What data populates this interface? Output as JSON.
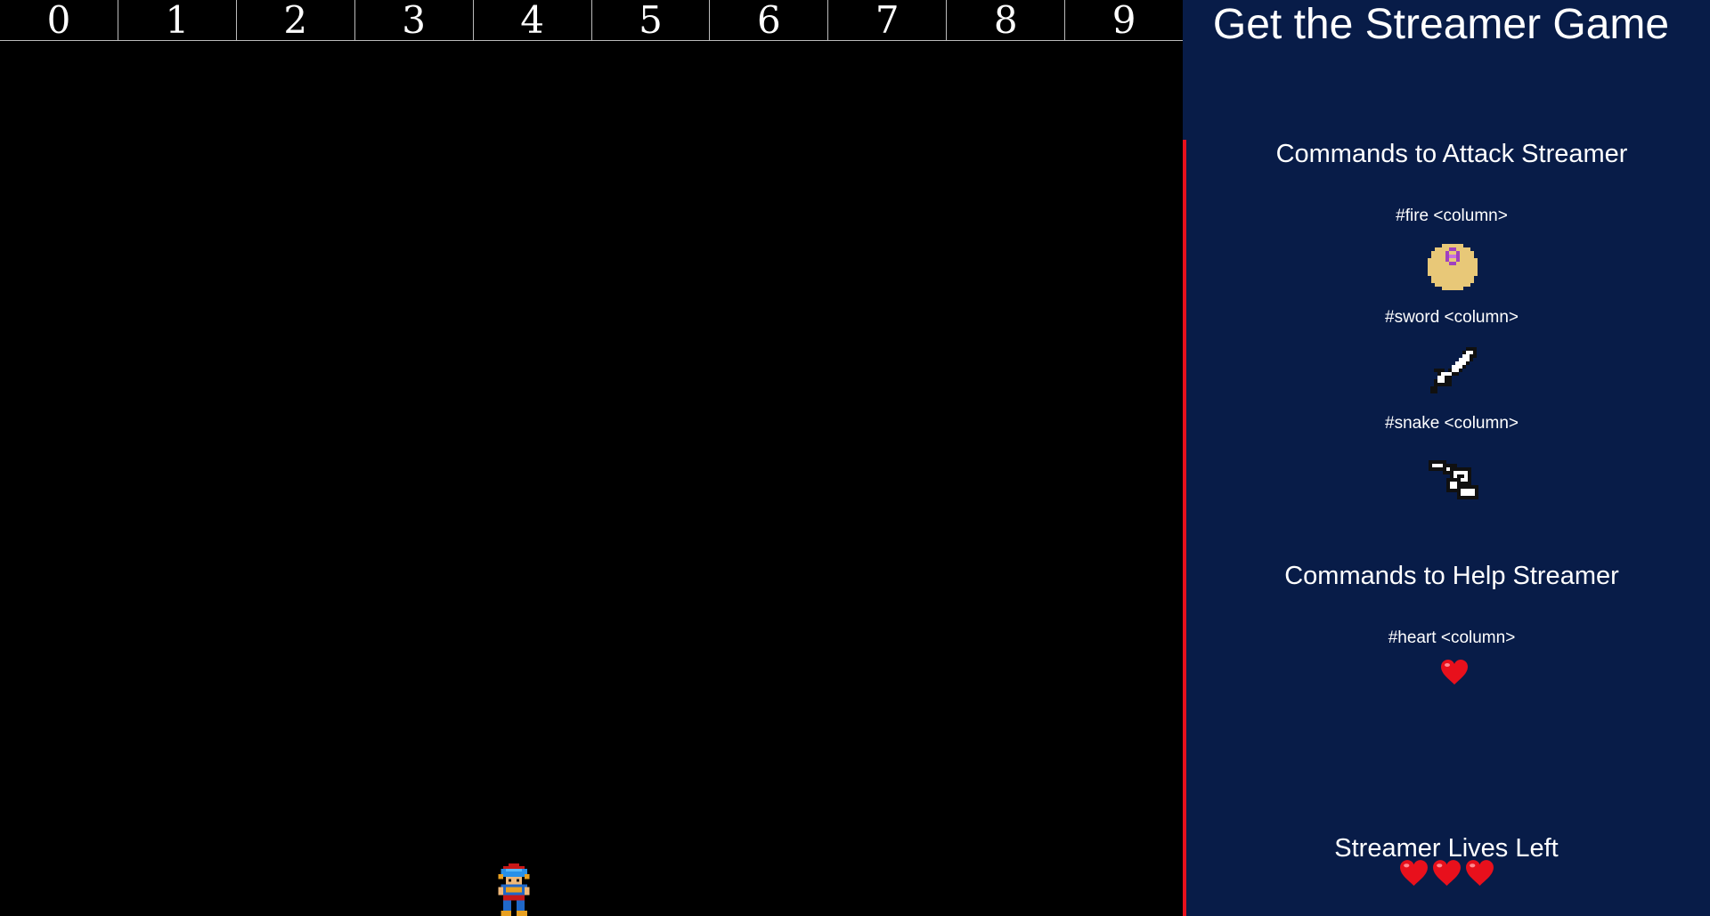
{
  "board": {
    "columns": [
      "0",
      "1",
      "2",
      "3",
      "4",
      "5",
      "6",
      "7",
      "8",
      "9"
    ]
  },
  "panel": {
    "title": "Get the Streamer Game",
    "attack": {
      "heading": "Commands to Attack Streamer",
      "commands": [
        {
          "label": "#fire <column>",
          "icon": "fireball-icon"
        },
        {
          "label": "#sword <column>",
          "icon": "sword-icon"
        },
        {
          "label": "#snake <column>",
          "icon": "snake-icon"
        }
      ]
    },
    "help": {
      "heading": "Commands to Help Streamer",
      "commands": [
        {
          "label": "#heart <column>",
          "icon": "heart-icon"
        }
      ]
    },
    "lives": {
      "heading": "Streamer Lives Left",
      "count": 3
    }
  },
  "colors": {
    "panel_background": "#081c48",
    "divider": "#e8101c",
    "board_background": "#000000",
    "heart": "#e8101c"
  }
}
